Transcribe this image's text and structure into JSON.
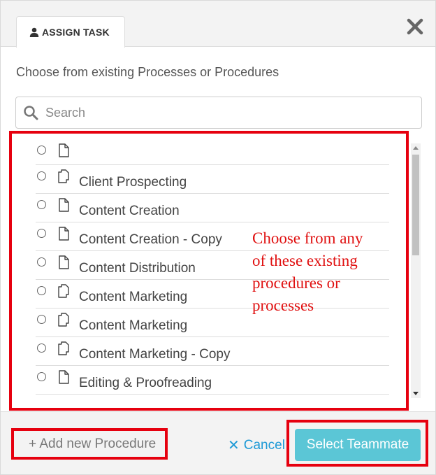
{
  "header": {
    "tab_label": "ASSIGN TASK",
    "tab_icon": "user-icon",
    "close_icon": "close-icon"
  },
  "body": {
    "intro": "Choose from existing Processes or Procedures",
    "search": {
      "placeholder": "Search",
      "value": ""
    }
  },
  "items": [
    {
      "label": "",
      "icon": "document-icon"
    },
    {
      "label": "Client Prospecting",
      "icon": "copy-icon"
    },
    {
      "label": "Content Creation",
      "icon": "document-icon"
    },
    {
      "label": "Content Creation - Copy",
      "icon": "document-icon"
    },
    {
      "label": "Content Distribution",
      "icon": "document-icon"
    },
    {
      "label": "Content Marketing",
      "icon": "copy-icon"
    },
    {
      "label": "Content Marketing",
      "icon": "copy-icon"
    },
    {
      "label": "Content Marketing - Copy",
      "icon": "copy-icon"
    },
    {
      "label": "Editing & Proofreading",
      "icon": "document-icon"
    }
  ],
  "annotation": {
    "lines": [
      "Choose from any",
      "of these existing",
      "procedures or",
      "processes"
    ],
    "color": "#e01010"
  },
  "footer": {
    "add_label": "+ Add new Procedure",
    "cancel_label": "Cancel",
    "select_label": "Select Teammate"
  },
  "colors": {
    "accent": "#5bc6d6",
    "link": "#1e9ad6",
    "highlight_box": "#e6000f"
  }
}
